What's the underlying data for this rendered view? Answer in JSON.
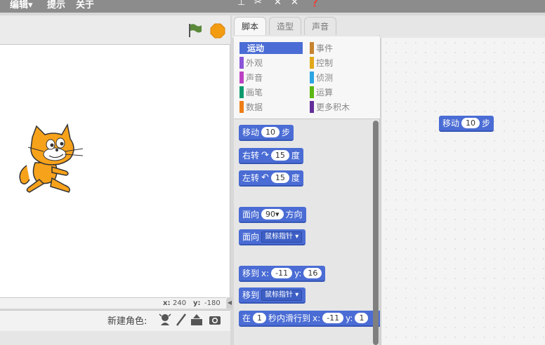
{
  "menubar": {
    "items": [
      "编辑▾",
      "提示",
      "关于"
    ]
  },
  "stage": {
    "coords": {
      "x_label": "x:",
      "x_value": "240",
      "y_label": "y:",
      "y_value": "-180"
    }
  },
  "sprites": {
    "new_sprite_label": "新建角色:"
  },
  "tabs": [
    "脚本",
    "造型",
    "声音"
  ],
  "categories": [
    {
      "label": "运动",
      "color": "#4a6cd4"
    },
    {
      "label": "事件",
      "color": "#c88330"
    },
    {
      "label": "外观",
      "color": "#8a55d7"
    },
    {
      "label": "控制",
      "color": "#e1a91a"
    },
    {
      "label": "声音",
      "color": "#bb42c3"
    },
    {
      "label": "侦测",
      "color": "#2ca5e2"
    },
    {
      "label": "画笔",
      "color": "#0e9a6c"
    },
    {
      "label": "运算",
      "color": "#5cb712"
    },
    {
      "label": "数据",
      "color": "#ee7d16"
    },
    {
      "label": "更多积木",
      "color": "#632d99"
    }
  ],
  "blocks": {
    "move": {
      "label": "移动",
      "steps": "10",
      "suffix": "步"
    },
    "turn_right": {
      "label": "右转",
      "deg": "15",
      "suffix": "度"
    },
    "turn_left": {
      "label": "左转",
      "deg": "15",
      "suffix": "度"
    },
    "point_dir": {
      "label": "面向",
      "value": "90▾",
      "suffix": "方向"
    },
    "point_towards": {
      "label": "面向",
      "target": "鼠标指针"
    },
    "goto_xy": {
      "label": "移到",
      "x_label": "x:",
      "x": "-11",
      "y_label": "y:",
      "y": "16"
    },
    "goto": {
      "label": "移到",
      "target": "鼠标指针"
    },
    "glide": {
      "label": "在",
      "secs": "1",
      "mid": "秒内滑行到",
      "x_label": "x:",
      "x": "-11",
      "y_label": "y:",
      "y": "1"
    }
  },
  "script": {
    "move": {
      "label": "移动",
      "steps": "10",
      "suffix": "步"
    }
  },
  "colors": {
    "motion": "#4a6cd4",
    "stop": "#f39c12"
  }
}
